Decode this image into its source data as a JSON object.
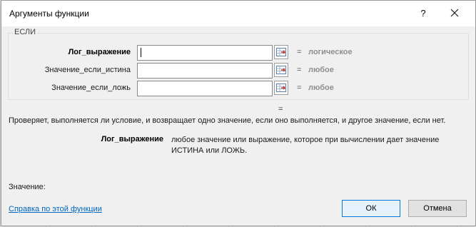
{
  "window": {
    "title": "Аргументы функции",
    "help_glyph": "?",
    "close_icon": "close-icon"
  },
  "function": {
    "name": "ЕСЛИ",
    "arguments": [
      {
        "label": "Лог_выражение",
        "value": "",
        "equals": "=",
        "result": "логическое",
        "focused": true
      },
      {
        "label": "Значение_если_истина",
        "value": "",
        "equals": "=",
        "result": "любое",
        "focused": false
      },
      {
        "label": "Значение_если_ложь",
        "value": "",
        "equals": "=",
        "result": "любое",
        "focused": false
      }
    ],
    "total_equals": "=",
    "description": "Проверяет, выполняется ли условие, и возвращает одно значение, если оно выполняется, и другое значение, если нет.",
    "param_name": "Лог_выражение",
    "param_description": "любое значение или выражение, которое при вычислении дает значение ИСТИНА или ЛОЖЬ."
  },
  "footer": {
    "result_label": "Значение:",
    "help_link": "Справка по этой функции",
    "ok_label": "ОК",
    "cancel_label": "Отмена"
  },
  "colors": {
    "accent": "#0078d7",
    "link": "#0067c0",
    "result_gray": "#8f8f8f"
  }
}
